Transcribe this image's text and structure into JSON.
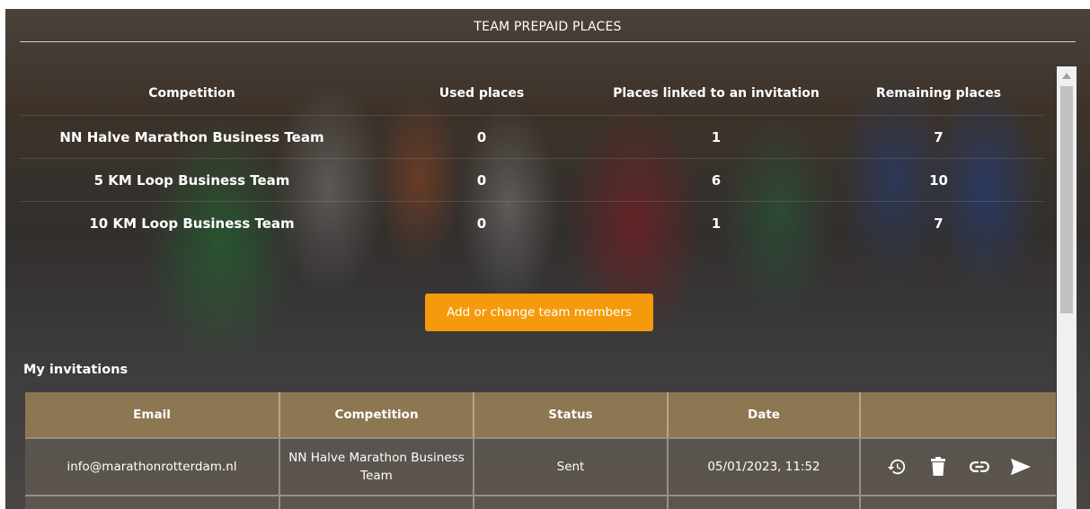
{
  "header": {
    "title": "TEAM PREPAID PLACES"
  },
  "places": {
    "columns": [
      "Competition",
      "Used places",
      "Places linked to an invitation",
      "Remaining places"
    ],
    "rows": [
      {
        "competition": "NN Halve Marathon Business Team",
        "used": "0",
        "linked": "1",
        "remaining": "7"
      },
      {
        "competition": "5 KM Loop Business Team",
        "used": "0",
        "linked": "6",
        "remaining": "10"
      },
      {
        "competition": "10 KM Loop Business Team",
        "used": "0",
        "linked": "1",
        "remaining": "7"
      }
    ]
  },
  "actions": {
    "add_members_label": "Add or change team members"
  },
  "invitations": {
    "label": "My invitations",
    "columns": [
      "Email",
      "Competition",
      "Status",
      "Date",
      ""
    ],
    "rows": [
      {
        "email": "info@marathonrotterdam.nl",
        "competition": "NN Halve Marathon Business Team",
        "status": "Sent",
        "date": "05/01/2023, 11:52"
      }
    ]
  },
  "icons": {
    "row_actions": [
      "history-icon",
      "trash-icon",
      "link-icon",
      "send-icon"
    ]
  },
  "colors": {
    "accent": "#f59a0b",
    "header_row": "#aa8c5a"
  }
}
